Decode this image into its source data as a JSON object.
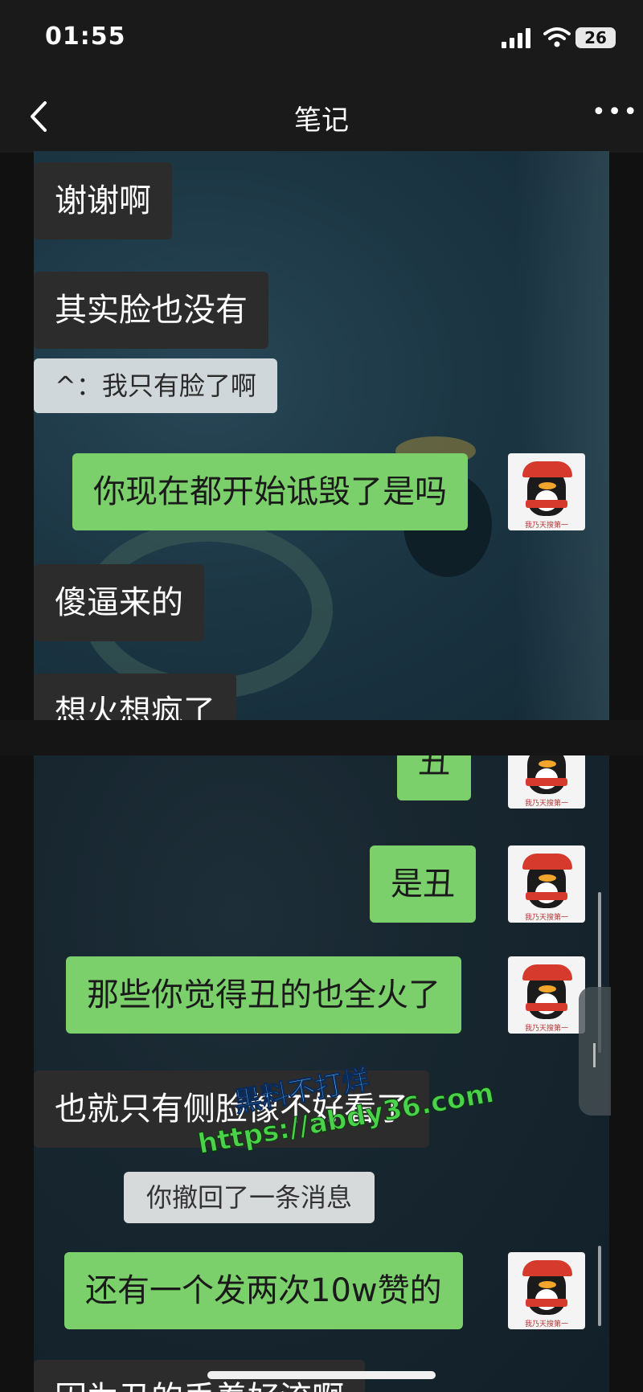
{
  "status_bar": {
    "time": "01:55",
    "battery": "26"
  },
  "nav": {
    "title": "笔记",
    "more": "•••"
  },
  "screenshot1": {
    "messages": [
      {
        "text": "谢谢啊"
      },
      {
        "text": "其实脸也没有"
      },
      {
        "text": "^：我只有脸了啊"
      },
      {
        "text": "你现在都开始诋毁了是吗"
      },
      {
        "text": "傻逼来的"
      },
      {
        "text": "想火想疯了"
      }
    ]
  },
  "screenshot2": {
    "messages": [
      {
        "text": "丑"
      },
      {
        "text": "是丑"
      },
      {
        "text": "那些你觉得丑的也全火了"
      },
      {
        "text": "也就只有侧脸像不好看了"
      },
      {
        "text": "你撤回了一条消息"
      },
      {
        "text": "还有一个发两次10w赞的"
      },
      {
        "text": "因为丑的丢着好流啊"
      }
    ]
  },
  "avatar_caption": "我乃天搜第一",
  "watermark": {
    "line1": "黑料不打烊",
    "line2": "https://abdy36.com"
  },
  "colors": {
    "sent_bubble": "#7bd06b",
    "recv_bubble": "#2c2c2c",
    "system_bubble": "#d7dadb"
  }
}
